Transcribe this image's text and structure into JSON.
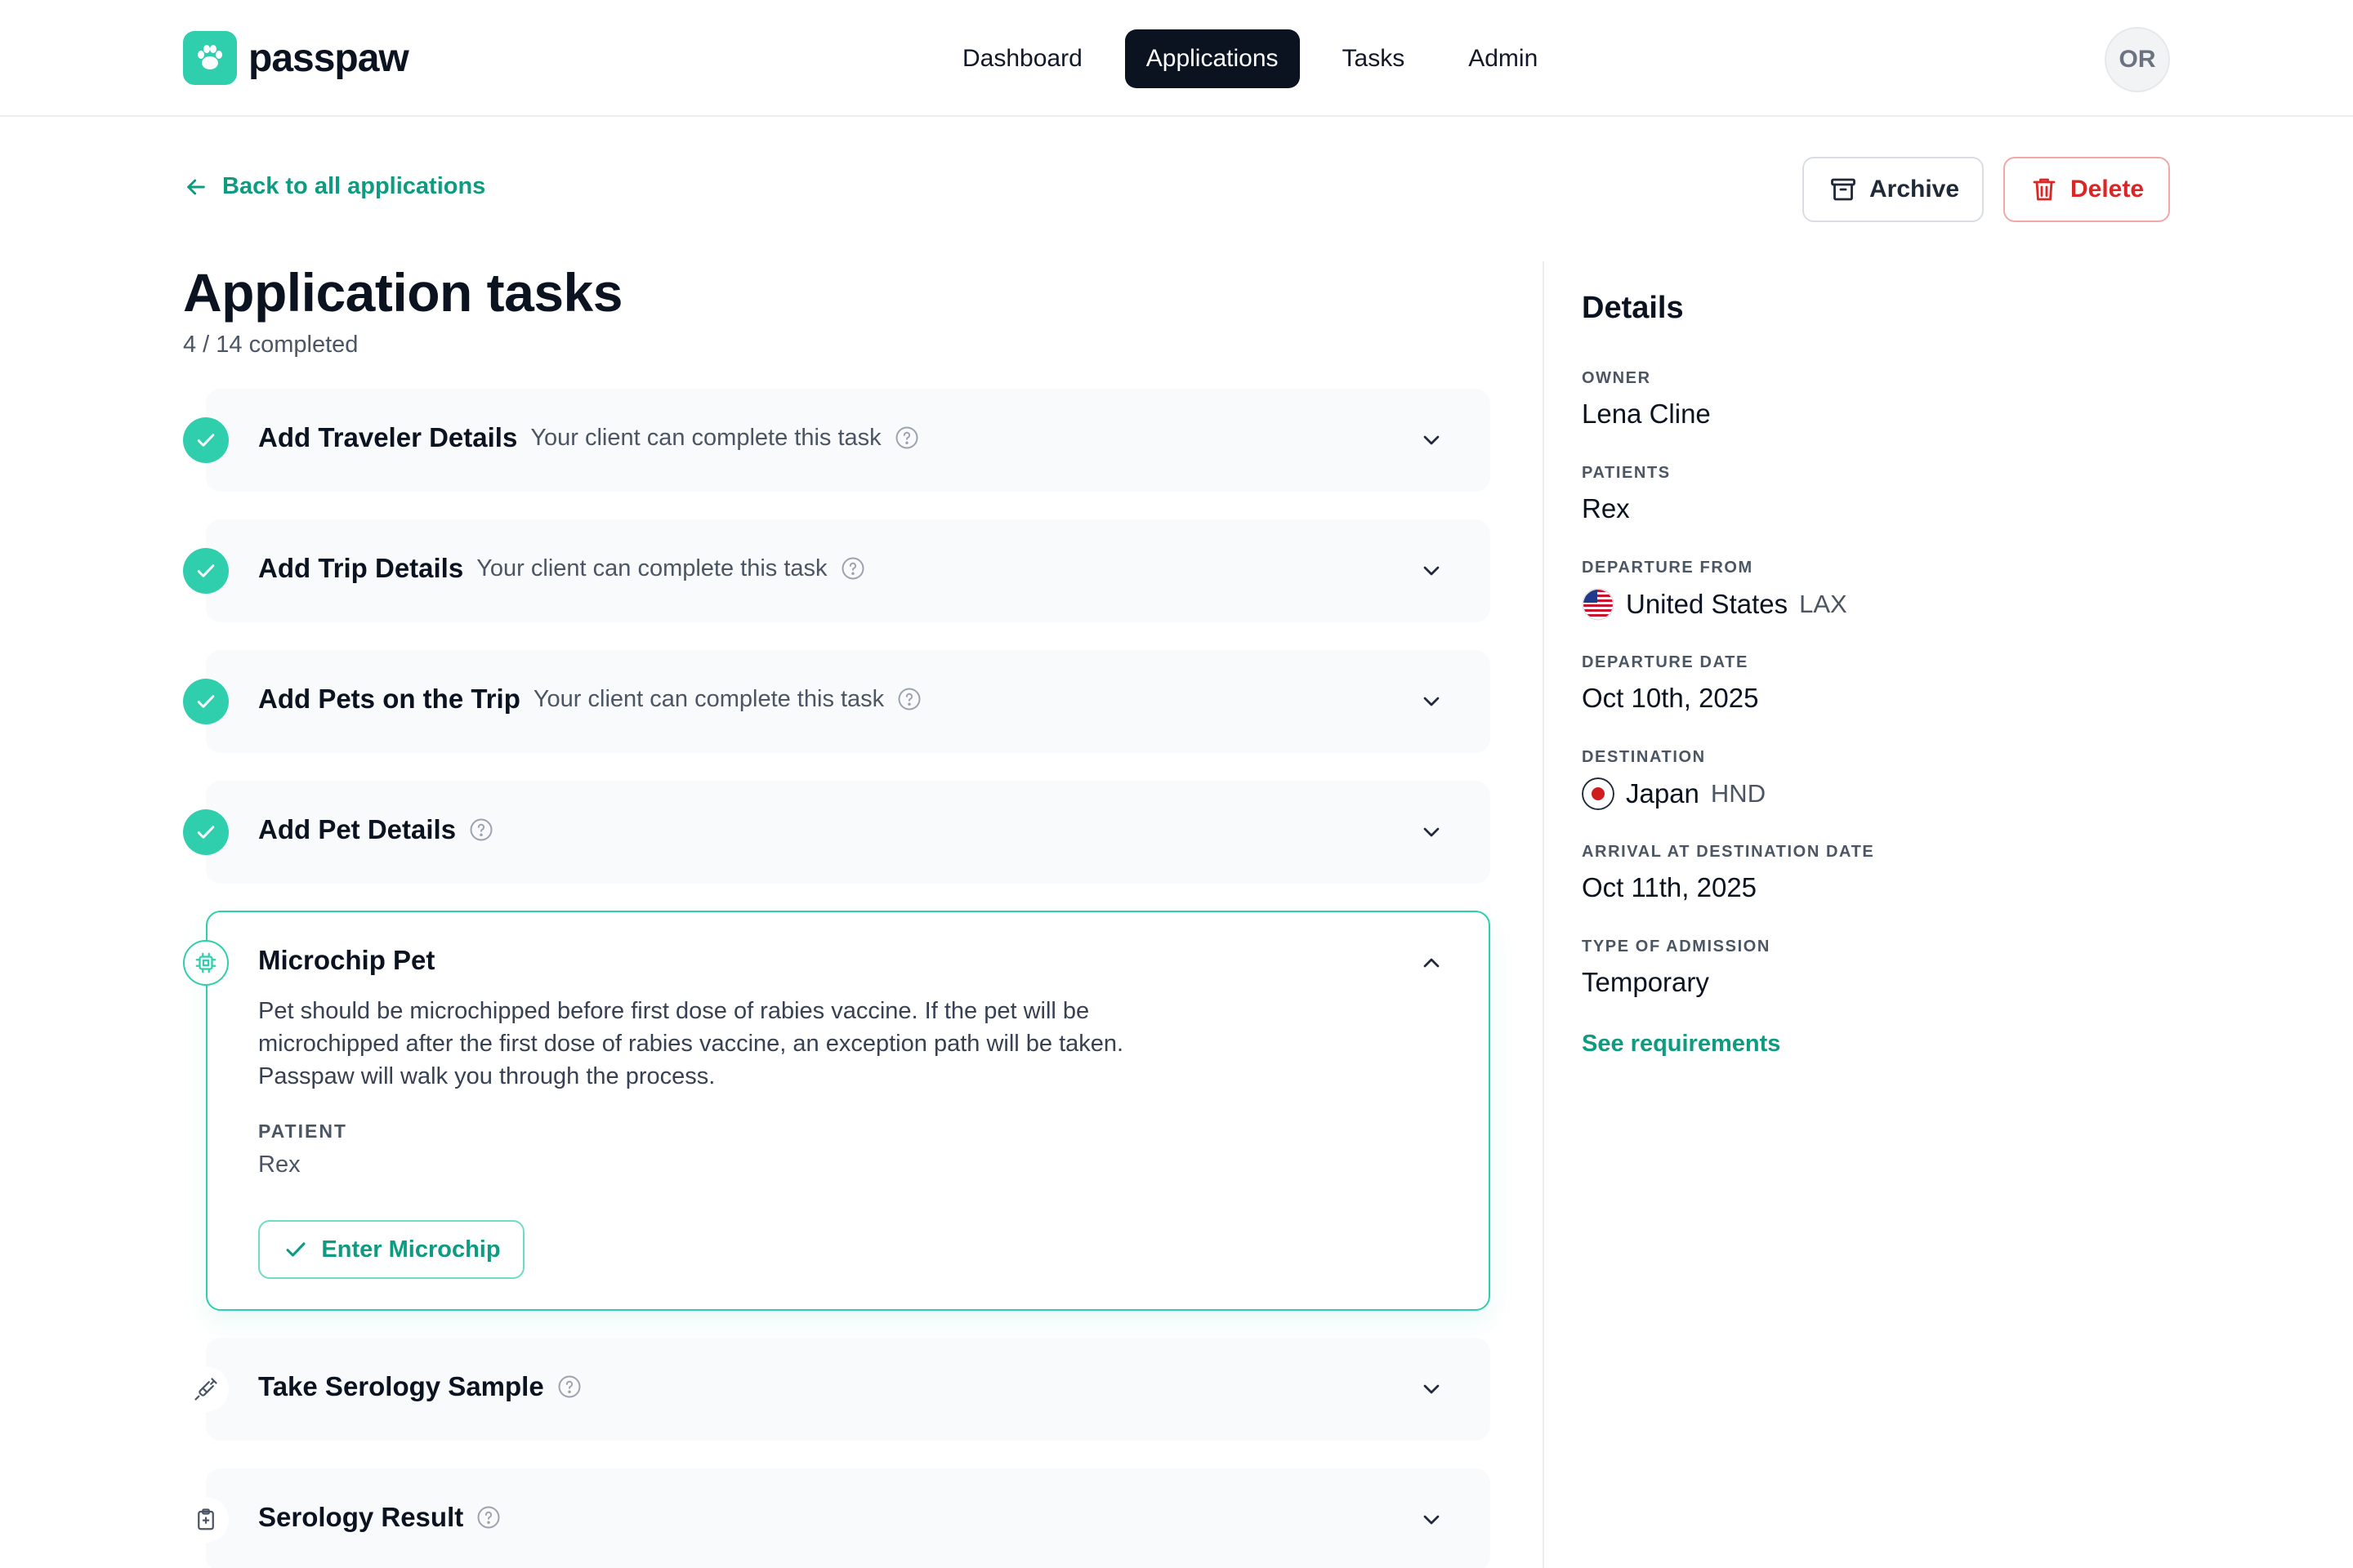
{
  "brand": {
    "name": "passpaw"
  },
  "nav": {
    "items": [
      {
        "label": "Dashboard"
      },
      {
        "label": "Applications"
      },
      {
        "label": "Tasks"
      },
      {
        "label": "Admin"
      }
    ],
    "active": "Applications"
  },
  "user": {
    "initials": "OR"
  },
  "header": {
    "back_label": "Back to all applications",
    "archive_label": "Archive",
    "delete_label": "Delete"
  },
  "page": {
    "title": "Application tasks",
    "progress": "4 / 14 completed"
  },
  "tasks": [
    {
      "title": "Add Traveler Details",
      "note": "Your client can complete this task",
      "status": "done"
    },
    {
      "title": "Add Trip Details",
      "note": "Your client can complete this task",
      "status": "done"
    },
    {
      "title": "Add Pets on the Trip",
      "note": "Your client can complete this task",
      "status": "done"
    },
    {
      "title": "Add Pet Details",
      "note": "",
      "status": "done"
    },
    {
      "title": "Microchip Pet",
      "status": "current",
      "description_lines": [
        "Pet should be microchipped before first dose of rabies vaccine. If the pet will be",
        "microchipped after the first dose of rabies vaccine, an exception path will be taken.",
        "Passpaw will walk you through the process."
      ],
      "patient_label": "PATIENT",
      "patient_value": "Rex",
      "action_label": "Enter Microchip"
    },
    {
      "title": "Take Serology Sample",
      "note": "",
      "status": "pending"
    },
    {
      "title": "Serology Result",
      "note": "",
      "status": "pending"
    }
  ],
  "details": {
    "title": "Details",
    "owner": {
      "label": "OWNER",
      "value": "Lena Cline"
    },
    "patients": {
      "label": "PATIENTS",
      "value": "Rex"
    },
    "departure_from": {
      "label": "DEPARTURE FROM",
      "country": "United States",
      "code": "LAX",
      "flag_icon": "us-flag-icon"
    },
    "departure_date": {
      "label": "DEPARTURE DATE",
      "value": "Oct 10th, 2025"
    },
    "destination": {
      "label": "DESTINATION",
      "country": "Japan",
      "code": "HND",
      "flag_icon": "japan-flag-icon"
    },
    "arrival_date": {
      "label": "ARRIVAL AT DESTINATION DATE",
      "value": "Oct 11th, 2025"
    },
    "admission_type": {
      "label": "TYPE OF ADMISSION",
      "value": "Temporary"
    },
    "requirements_link": "See requirements"
  },
  "colors": {
    "accent": "#2fcfad",
    "accent_text": "#0f9b80",
    "danger": "#dc2626",
    "nav_active_bg": "#0b1220"
  }
}
